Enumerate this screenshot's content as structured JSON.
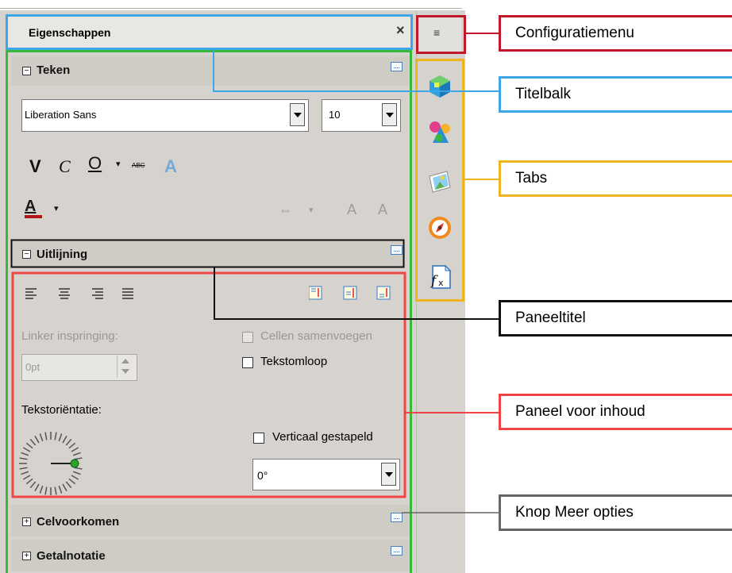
{
  "sidebar": {
    "title": "Eigenschappen",
    "close_glyph": "×",
    "menu_glyph": "≡"
  },
  "panels": {
    "teken": {
      "title": "Teken",
      "toggle": "−",
      "font_name": "Liberation Sans",
      "font_size": "10",
      "bold": "V",
      "italic": "C",
      "underline": "O",
      "strikethrough": "ABC",
      "shadow": "A",
      "font_color": "A"
    },
    "uitlijning": {
      "title": "Uitlijning",
      "toggle": "−",
      "indent_label": "Linker inspringing:",
      "indent_value": "0pt",
      "merge_label": "Cellen samenvoegen",
      "wrap_label": "Tekstomloop",
      "orientation_label": "Tekstoriëntatie:",
      "stacked_label": "Verticaal gestapeld",
      "rotation_value": "0°"
    },
    "celvoorkomen": {
      "title": "Celvoorkomen",
      "toggle": "+"
    },
    "getalnotatie": {
      "title": "Getalnotatie",
      "toggle": "+"
    }
  },
  "annotations": [
    {
      "label": "Configuratiemenu",
      "color": "#c0182a"
    },
    {
      "label": "Titelbalk",
      "color": "#3da6e6"
    },
    {
      "label": "Tabs",
      "color": "#f0b422"
    },
    {
      "label": "Paneeltitel",
      "color": "#111111"
    },
    {
      "label": "Paneel voor inhoud",
      "color": "#f04545"
    },
    {
      "label": "Knop Meer opties",
      "color": "#666666"
    }
  ],
  "outline_colors": {
    "title_bar": "#3da6e6",
    "deck": "#38b838",
    "tabs": "#f0b422",
    "panel_title": "#111111",
    "content_panel": "#f04545",
    "config_menu": "#c0182a",
    "more_options": "#666666"
  },
  "tabs": [
    {
      "name": "properties-tab"
    },
    {
      "name": "styles-tab"
    },
    {
      "name": "gallery-tab"
    },
    {
      "name": "navigator-tab"
    },
    {
      "name": "functions-tab"
    }
  ]
}
